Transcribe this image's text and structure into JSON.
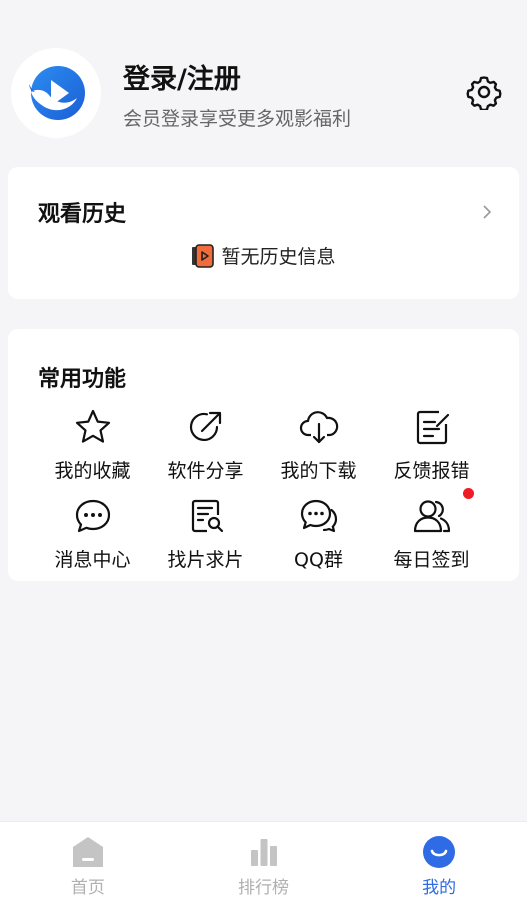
{
  "header": {
    "login_title": "登录/注册",
    "login_subtitle": "会员登录享受更多观影福利",
    "avatar_icon": "whale-logo-icon",
    "settings_icon": "gear-icon"
  },
  "history": {
    "title": "观看历史",
    "empty_text": "暂无历史信息",
    "empty_icon": "video-file-icon"
  },
  "functions": {
    "title": "常用功能",
    "items": [
      {
        "label": "我的收藏",
        "icon": "star-icon"
      },
      {
        "label": "软件分享",
        "icon": "share-icon"
      },
      {
        "label": "我的下载",
        "icon": "cloud-download-icon"
      },
      {
        "label": "反馈报错",
        "icon": "feedback-edit-icon"
      },
      {
        "label": "消息中心",
        "icon": "chat-bubble-icon"
      },
      {
        "label": "找片求片",
        "icon": "search-document-icon"
      },
      {
        "label": "QQ群",
        "icon": "group-chat-icon"
      },
      {
        "label": "每日签到",
        "icon": "users-icon"
      }
    ]
  },
  "nav": {
    "items": [
      {
        "label": "首页",
        "icon": "home-icon"
      },
      {
        "label": "排行榜",
        "icon": "bar-chart-icon"
      },
      {
        "label": "我的",
        "icon": "smile-icon"
      }
    ],
    "active_color": "#2f6be4",
    "inactive_color": "#b0b0b0"
  }
}
